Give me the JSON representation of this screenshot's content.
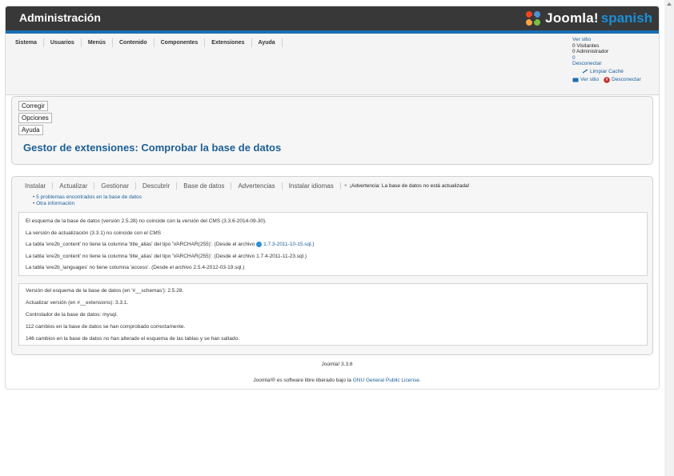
{
  "header": {
    "title": "Administración",
    "logo_word": "Joomla!",
    "logo_lang": "spanish"
  },
  "menu": [
    "Sistema",
    "Usuarios",
    "Menús",
    "Contenido",
    "Componentes",
    "Extensiones",
    "Ayuda"
  ],
  "status": {
    "view_site": "Ver sitio",
    "visitors": "0 Visitantes",
    "admins": "0 Administrador",
    "messages": "0",
    "logout": "Desconectar",
    "clear_cache": "Limpiar Caché",
    "view_site2": "Ver sitio",
    "logout2": "Desconectar"
  },
  "toolbar": {
    "corregir": "Corregir",
    "opciones": "Opciones",
    "ayuda": "Ayuda"
  },
  "page_title": "Gestor de extensiones: Comprobar la base de datos",
  "tabs": [
    "Instalar",
    "Actualizar",
    "Gestionar",
    "Descubrir",
    "Base de datos",
    "Advertencias",
    "Instalar idiomas"
  ],
  "warning": {
    "close": "×",
    "text": "¡Advertencia: La base de datos no está actualizada!"
  },
  "sublinks": [
    "5 problemas encontrados en la base de datos",
    "Otra información"
  ],
  "problems": [
    {
      "text": "El esquema de la base de datos (versión 2.5.28) no coincide con la versión del CMS (3.3.6-2014-09-30)."
    },
    {
      "text": "La versión de actualización (3.3.1) no coincide con el CMS"
    },
    {
      "text": "La tabla 'ere2b_content' no tiene la columna 'title_alias' del tipo 'VARCHAR(255)'. (Desde el archivo ",
      "file": "1.7.3-2011-10-15.sql",
      "suffix": ".)"
    },
    {
      "text": "La tabla 'ere2b_content' no tiene la columna 'title_alias' del tipo 'VARCHAR(255)'. (Desde el archivo 1.7.4-2011-11-23.sql.)"
    },
    {
      "text": "La tabla 'ere2b_languages' no tiene columna 'access'. (Desde el archivo 2.5.4-2012-03-19.sql.)"
    }
  ],
  "info": [
    "Versión del esquema de la base de datos (en '#__schemas'): 2.5.28.",
    "Actualizar versión (en #__extensions): 3.3.1.",
    "Controlador de la base de datos: mysql.",
    "112 cambios en la base de datos se han comprobado correctamente.",
    "146 cambios en la base de datos no han alterado el esquema de las tablas y se han saltado."
  ],
  "footer": {
    "version": "Joomla! 3.3.6",
    "license_pre": "Joomla!® es software libre liberado bajo la ",
    "license_link": "GNU General Public License",
    "license_post": "."
  },
  "colors": {
    "header_bg": "#383838",
    "accent_blue": "#1a6fb4",
    "title_blue": "#1c5f95",
    "link_blue": "#1a5f9a"
  }
}
